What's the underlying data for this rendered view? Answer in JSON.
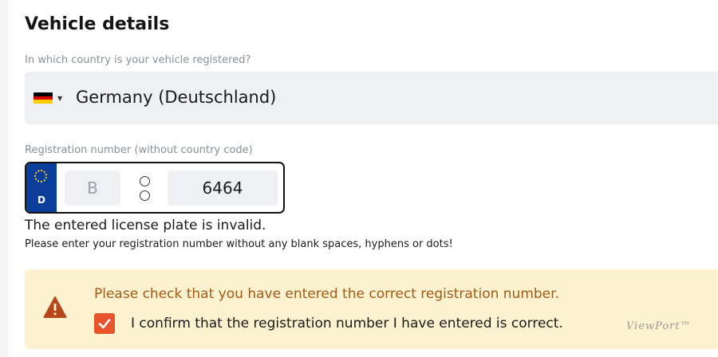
{
  "section_title": "Vehicle details",
  "country": {
    "label": "In which country is your vehicle registered?",
    "flag_icon": "germany-flag-icon",
    "value": "Germany (Deutschland)"
  },
  "registration": {
    "label": "Registration number (without country code)",
    "country_code": "D",
    "city_code": "B",
    "number": "6464"
  },
  "error": {
    "title": "The entered license plate is invalid.",
    "hint": "Please enter your registration number without any blank spaces, hyphens or dots!"
  },
  "warning": {
    "message": "Please check that you have entered the correct registration number.",
    "confirm_label": "I confirm that the registration number I have entered is correct.",
    "confirm_checked": true
  },
  "watermark": "ViewPort™",
  "colors": {
    "warning_bg": "#fdf2d0",
    "warning_text": "#a25b16",
    "checkbox": "#e9532c",
    "eu_blue": "#0b3d9a"
  }
}
